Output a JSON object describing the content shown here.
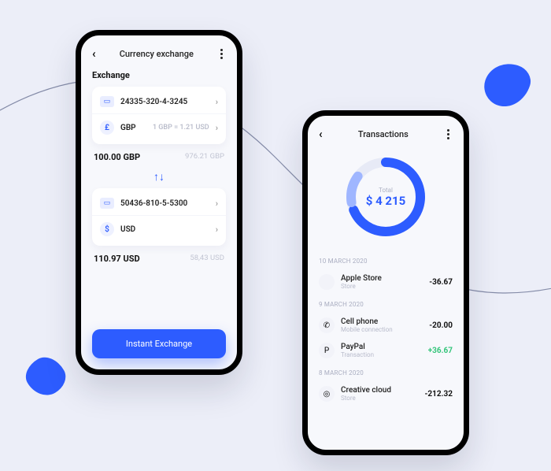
{
  "exchange": {
    "header": "Currency exchange",
    "section_label": "Exchange",
    "swap_icon": "↑↓",
    "from": {
      "account_no": "24335-320-4-3245",
      "currency_code": "GBP",
      "currency_symbol": "£",
      "rate_text": "1 GBP = 1.21 USD",
      "amount": "100.00 GBP",
      "balance": "976.21 GBP"
    },
    "to": {
      "account_no": "50436-810-5-5300",
      "currency_code": "USD",
      "currency_symbol": "$",
      "amount": "110.97 USD",
      "balance": "58,43 USD"
    },
    "cta": "Instant Exchange"
  },
  "transactions": {
    "header": "Transactions",
    "total_label": "Total",
    "total_value": "$ 4 215",
    "groups": [
      {
        "date": "10 MARCH 2020",
        "items": [
          {
            "icon": "",
            "name": "Apple Store",
            "sub": "Store",
            "value": "-36.67",
            "sign": "neg"
          }
        ]
      },
      {
        "date": "9 MARCH 2020",
        "items": [
          {
            "icon": "✆",
            "name": "Cell phone",
            "sub": "Mobile connection",
            "value": "-20.00",
            "sign": "neg"
          },
          {
            "icon": "P",
            "name": "PayPal",
            "sub": "Transaction",
            "value": "+36.67",
            "sign": "pos"
          }
        ]
      },
      {
        "date": "8 MARCH 2020",
        "items": [
          {
            "icon": "◎",
            "name": "Creative cloud",
            "sub": "Store",
            "value": "-212.32",
            "sign": "neg"
          }
        ]
      }
    ]
  }
}
